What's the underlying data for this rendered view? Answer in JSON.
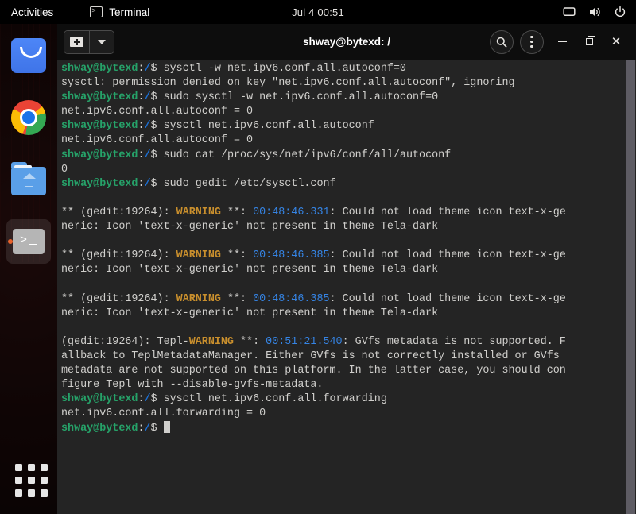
{
  "topbar": {
    "activities": "Activities",
    "app_icon": "terminal-icon",
    "app_name": "Terminal",
    "clock": "Jul 4  00:51",
    "indicators": [
      {
        "name": "display-icon",
        "label": "screen"
      },
      {
        "name": "volume-icon",
        "label": "volume"
      },
      {
        "name": "power-icon",
        "label": "power"
      }
    ]
  },
  "dock": {
    "items": [
      {
        "name": "dock-item-software",
        "label": "Software",
        "icon": "store-icon",
        "active": false
      },
      {
        "name": "dock-item-chrome",
        "label": "Google Chrome",
        "icon": "chrome-icon",
        "active": false
      },
      {
        "name": "dock-item-files",
        "label": "Files",
        "icon": "files-home-icon",
        "active": false
      },
      {
        "name": "dock-item-terminal",
        "label": "Terminal",
        "icon": "terminal-icon",
        "active": true
      }
    ],
    "show_apps_label": "Show Applications"
  },
  "window": {
    "title": "shway@bytexd: /",
    "newtab_label": "New Tab",
    "newtab_menu_label": "New Tab Options",
    "search_label": "Search",
    "menu_label": "Menu",
    "minimize_label": "Minimize",
    "maximize_label": "Restore",
    "close_label": "Close"
  },
  "terminal": {
    "prompt_user": "shway@bytexd",
    "prompt_colon": ":",
    "prompt_path": "/",
    "prompt_sym": "$ ",
    "lines": [
      {
        "type": "prompt",
        "cmd": "sysctl -w net.ipv6.conf.all.autoconf=0"
      },
      {
        "type": "out",
        "text": "sysctl: permission denied on key \"net.ipv6.conf.all.autoconf\", ignoring"
      },
      {
        "type": "prompt",
        "cmd": "sudo sysctl -w net.ipv6.conf.all.autoconf=0"
      },
      {
        "type": "out",
        "text": "net.ipv6.conf.all.autoconf = 0"
      },
      {
        "type": "prompt",
        "cmd": "sysctl net.ipv6.conf.all.autoconf"
      },
      {
        "type": "out",
        "text": "net.ipv6.conf.all.autoconf = 0"
      },
      {
        "type": "prompt",
        "cmd": "sudo cat /proc/sys/net/ipv6/conf/all/autoconf"
      },
      {
        "type": "out",
        "text": "0"
      },
      {
        "type": "prompt",
        "cmd": "sudo gedit /etc/sysctl.conf"
      },
      {
        "type": "blank",
        "text": ""
      },
      {
        "type": "warn",
        "pre": "** (gedit:19264): ",
        "warn": "WARNING",
        "mid": " **: ",
        "time": "00:48:46.331",
        "post": ": Could not load theme icon text-x-ge"
      },
      {
        "type": "out",
        "text": "neric: Icon 'text-x-generic' not present in theme Tela-dark"
      },
      {
        "type": "blank",
        "text": ""
      },
      {
        "type": "warn",
        "pre": "** (gedit:19264): ",
        "warn": "WARNING",
        "mid": " **: ",
        "time": "00:48:46.385",
        "post": ": Could not load theme icon text-x-ge"
      },
      {
        "type": "out",
        "text": "neric: Icon 'text-x-generic' not present in theme Tela-dark"
      },
      {
        "type": "blank",
        "text": ""
      },
      {
        "type": "warn",
        "pre": "** (gedit:19264): ",
        "warn": "WARNING",
        "mid": " **: ",
        "time": "00:48:46.385",
        "post": ": Could not load theme icon text-x-ge"
      },
      {
        "type": "out",
        "text": "neric: Icon 'text-x-generic' not present in theme Tela-dark"
      },
      {
        "type": "blank",
        "text": ""
      },
      {
        "type": "warn",
        "pre": "(gedit:19264): Tepl-",
        "warn": "WARNING",
        "mid": " **: ",
        "time": "00:51:21.540",
        "post": ": GVfs metadata is not supported. F"
      },
      {
        "type": "out",
        "text": "allback to TeplMetadataManager. Either GVfs is not correctly installed or GVfs"
      },
      {
        "type": "out",
        "text": "metadata are not supported on this platform. In the latter case, you should con"
      },
      {
        "type": "out",
        "text": "figure Tepl with --disable-gvfs-metadata."
      },
      {
        "type": "prompt",
        "cmd": "sysctl net.ipv6.conf.all.forwarding"
      },
      {
        "type": "out",
        "text": "net.ipv6.conf.all.forwarding = 0"
      },
      {
        "type": "cursor",
        "cmd": ""
      }
    ]
  },
  "colors": {
    "terminal_bg": "#242424",
    "titlebar_bg": "#0d0d0d",
    "topbar_bg": "#000000",
    "prompt_green": "#26a269",
    "path_blue": "#1c71d8",
    "warning_orange": "#c98f2d",
    "time_blue": "#3584e4",
    "text_fg": "#d0cfcc",
    "scrollbar": "#5e5c64",
    "dock_active_dot": "#e8622c"
  }
}
